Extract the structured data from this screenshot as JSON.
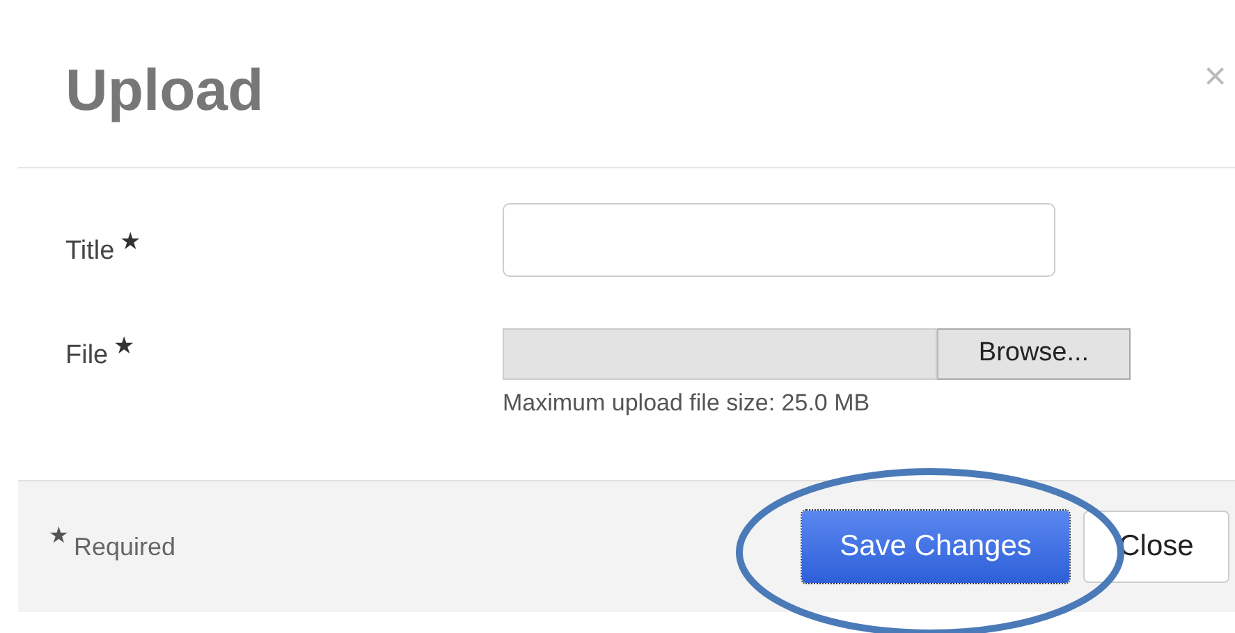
{
  "dialog": {
    "title": "Upload",
    "close_icon": "×"
  },
  "fields": [
    {
      "kind": "text",
      "label": "Title",
      "required_mark": "★"
    },
    {
      "kind": "file",
      "label": "File",
      "required_mark": "★",
      "button": "Browse...",
      "help": "Maximum upload file size: 25.0 MB"
    }
  ],
  "footer": {
    "required_mark": "★",
    "required_note": "Required",
    "buttons": [
      {
        "label": "Save Changes",
        "kind": "primary"
      },
      {
        "label": "Close",
        "kind": "default"
      }
    ]
  }
}
